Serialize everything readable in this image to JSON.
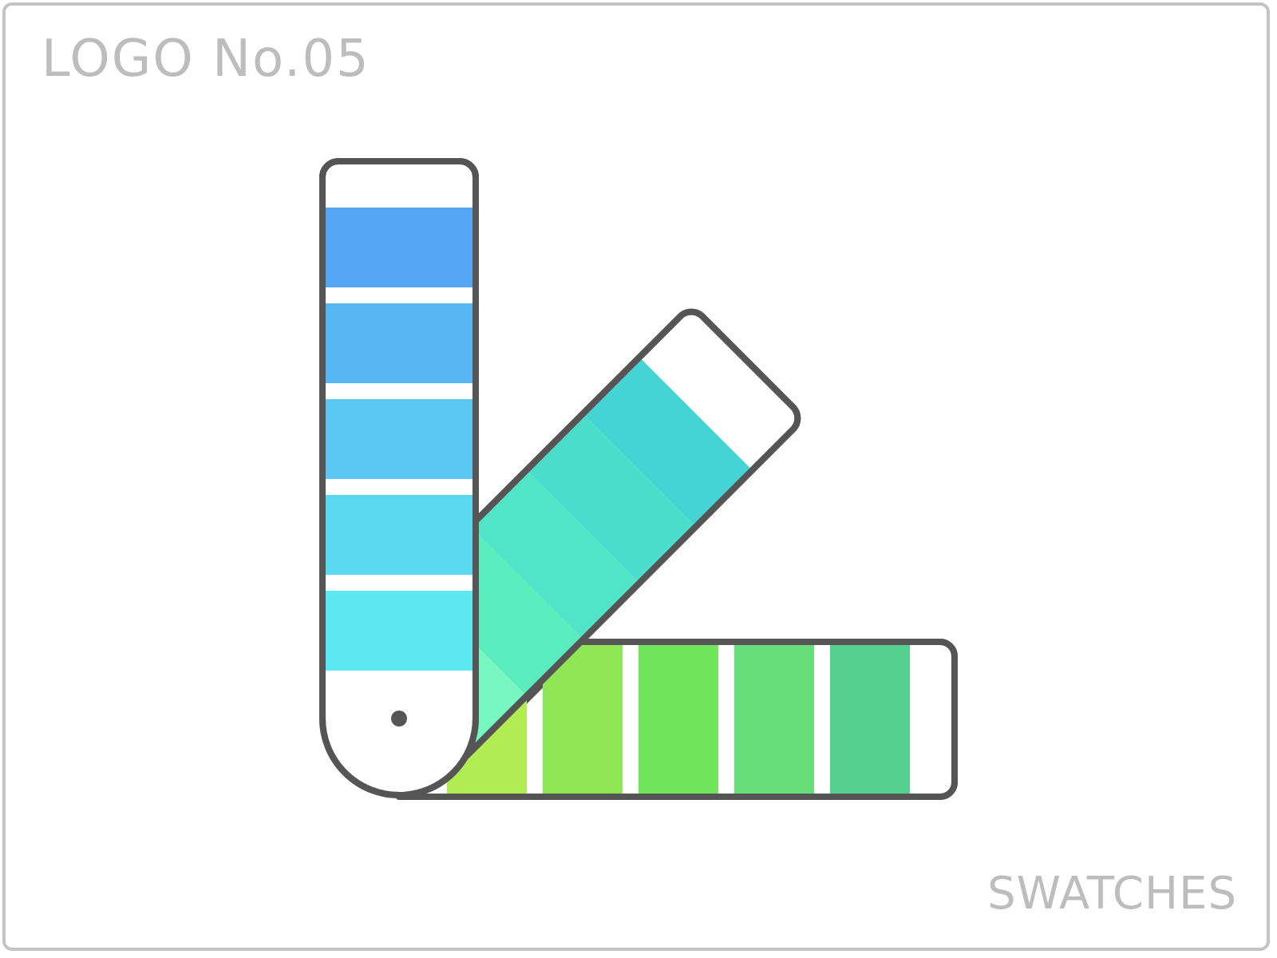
{
  "header": {
    "title": "LOGO No.05"
  },
  "footer": {
    "caption": "SWATCHES"
  },
  "icon": {
    "name": "color-swatches-icon"
  },
  "colors": {
    "outline": "#555555",
    "frame": "#c3c3c3",
    "text": "#bdbdbd",
    "vertical_strip": [
      "#55a6f2",
      "#57b6f1",
      "#5bc8f3",
      "#5bd8f1",
      "#5de8f2"
    ],
    "diagonal_strip": [
      "#45d3d4",
      "#4cdccb",
      "#52e4c6",
      "#5aeebe",
      "#76f6c0"
    ],
    "horizontal_strip": [
      "#b0ec52",
      "#8fe756",
      "#70e45a",
      "#67de7b",
      "#55d08e"
    ]
  }
}
